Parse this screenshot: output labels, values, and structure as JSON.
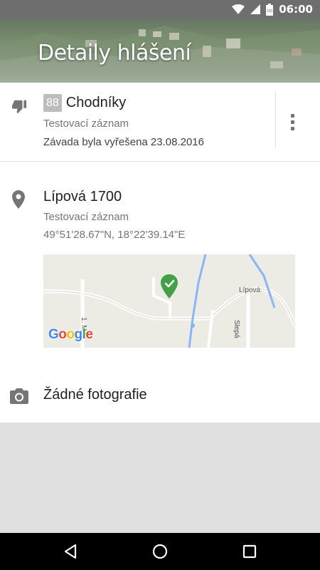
{
  "status_bar": {
    "time": "06:00",
    "battery_level": "100",
    "icons": [
      "wifi-icon",
      "signal-icon",
      "battery-icon"
    ]
  },
  "header": {
    "title": "Detaily hlášení"
  },
  "report": {
    "code": "88",
    "category": "Chodníky",
    "description": "Testovací záznam",
    "status": "Závada byla vyřešena 23.08.2016",
    "icon": "thumbs-down-icon",
    "menu_icon": "more-vert-icon"
  },
  "location": {
    "address": "Lípová 1700",
    "description": "Testovací záznam",
    "coordinates": "49°51'28.67\"N, 18°22'39.14\"E",
    "icon": "location-pin-icon",
    "map": {
      "labels": {
        "street_lipova": "Lípová",
        "street_slepa": "Slepá",
        "street_1_maje": "1. M"
      },
      "logo": "Google",
      "marker_color": "#43a047",
      "water_color": "#8ab4f8"
    }
  },
  "photos": {
    "label": "Žádné fotografie",
    "icon": "camera-icon"
  },
  "nav_bar": {
    "icons": [
      "back-icon",
      "home-icon",
      "recents-icon"
    ]
  },
  "colors": {
    "status_bar": "#6e6e6e",
    "empty_area": "#e0e0e0",
    "badge": "#bdbdbd"
  }
}
